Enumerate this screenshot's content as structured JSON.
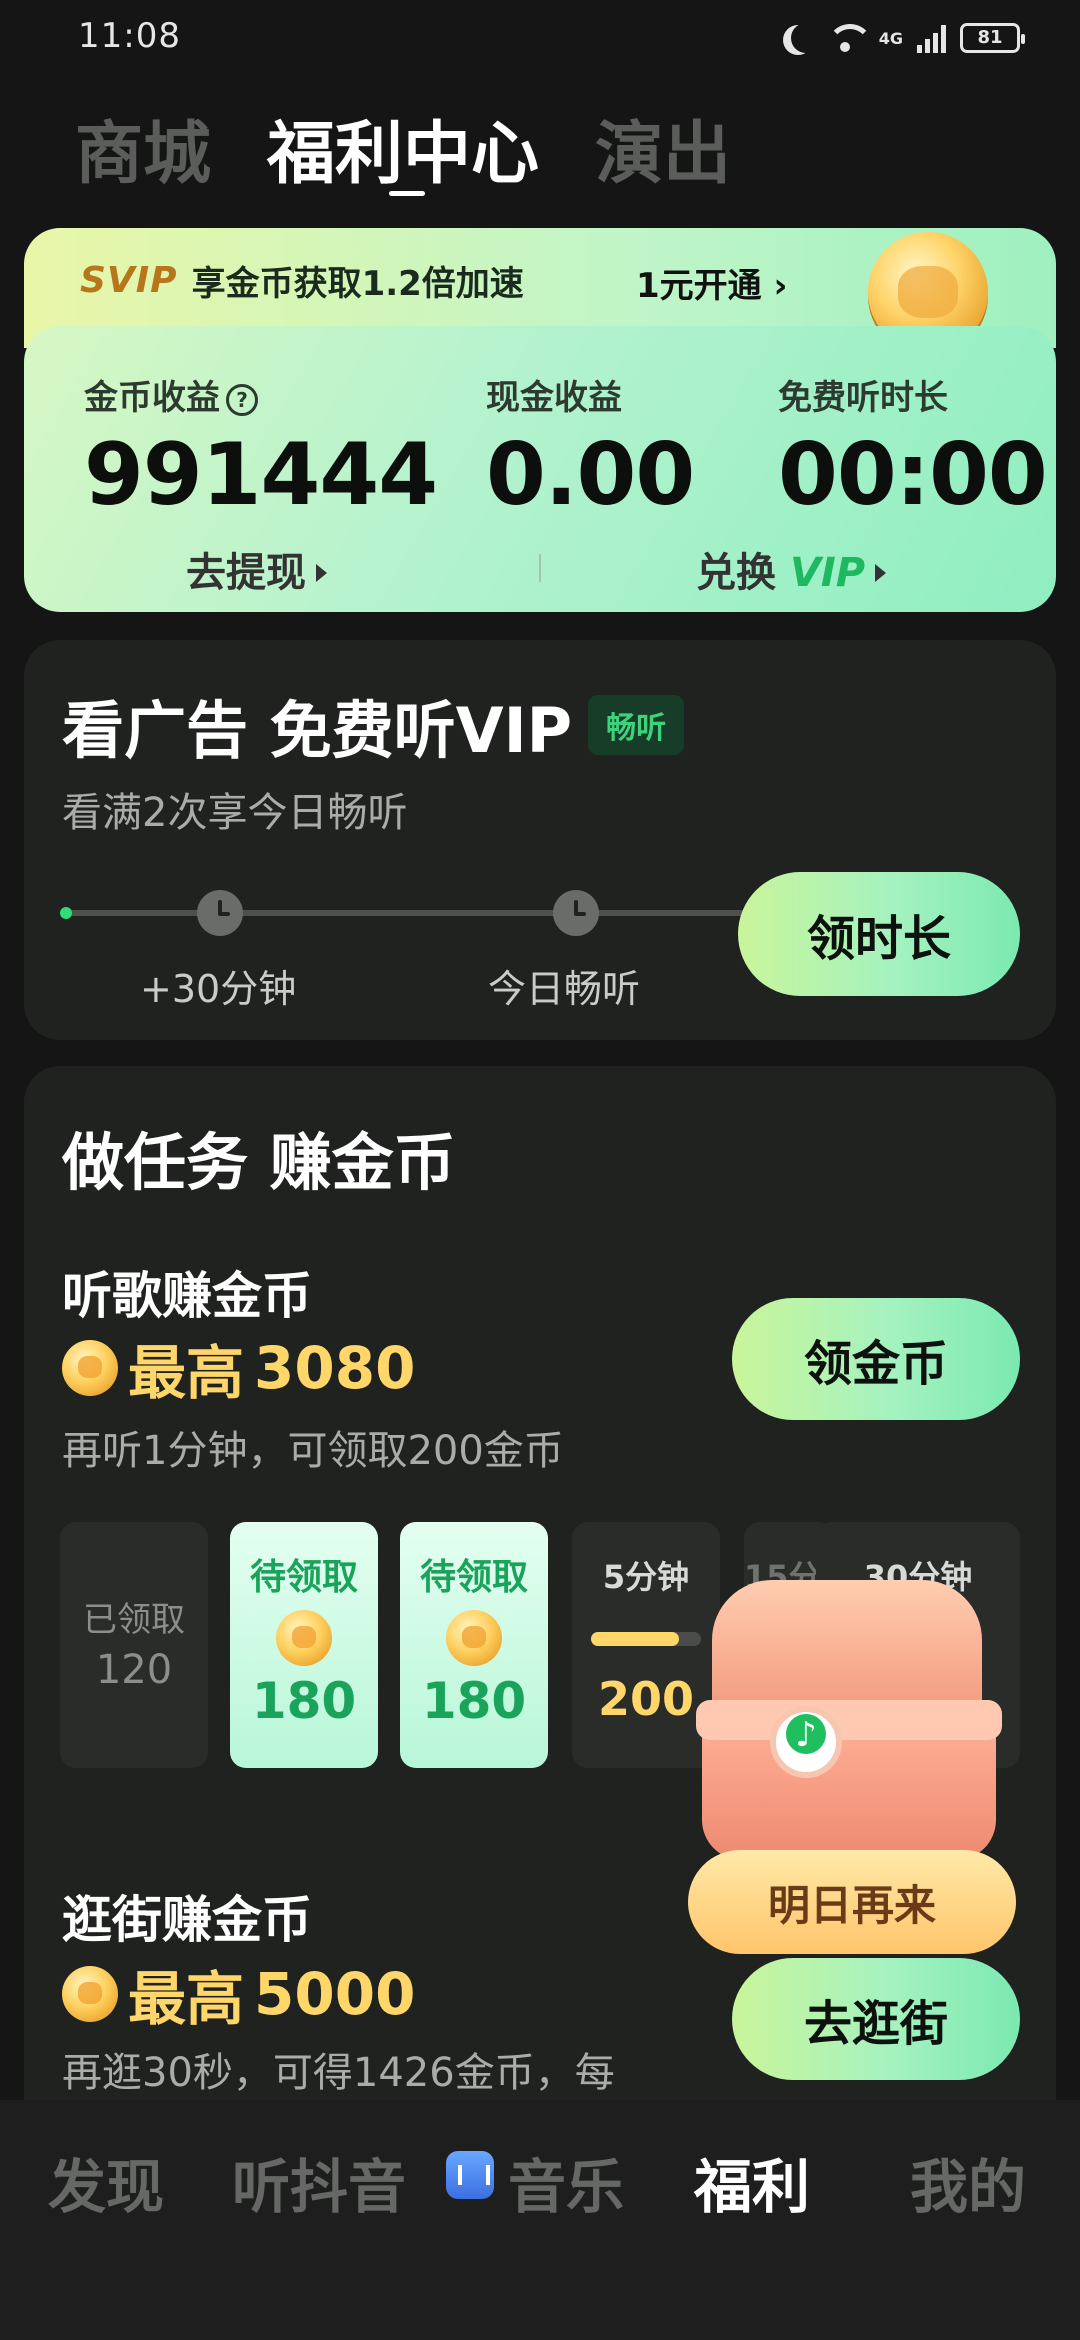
{
  "status": {
    "time": "11:08",
    "network": "4G",
    "battery": "81"
  },
  "top_tabs": [
    "商城",
    "福利中心",
    "演出"
  ],
  "vip_strip": {
    "badge": "SVIP",
    "text": "享金币获取1.2倍加速",
    "open_label": "1元开通 ›"
  },
  "stats": {
    "coins": {
      "label": "金币收益",
      "value": "991444"
    },
    "cash": {
      "label": "现金收益",
      "value": "0.00"
    },
    "free_time": {
      "label": "免费听时长",
      "value": "00:00"
    }
  },
  "card_links": {
    "withdraw": "去提现",
    "exchange_prefix": "兑换",
    "exchange_vip": "VIP"
  },
  "ad_section": {
    "title": "看广告 免费听VIP",
    "badge": "畅听",
    "subtitle": "看满2次享今日畅听",
    "node1_label": "+30分钟",
    "node2_label": "今日畅听",
    "button": "领时长"
  },
  "task_section": {
    "title": "做任务 赚金币",
    "listen": {
      "title": "听歌赚金币",
      "max_prefix": "最高",
      "max_value": "3080",
      "desc": "再听1分钟，可领取200金币",
      "button": "领金币"
    },
    "slots": [
      {
        "status": "已领取",
        "value": "120"
      },
      {
        "status": "待领取",
        "value": "180"
      },
      {
        "status": "待领取",
        "value": "180"
      },
      {
        "status": "5分钟",
        "value": "200",
        "progress": 0.8
      },
      {
        "status": "15分钟",
        "value": ""
      },
      {
        "status": "30分钟",
        "value": ""
      }
    ],
    "chest_label": "明日再来",
    "shop": {
      "title": "逛街赚金币",
      "max_prefix": "最高",
      "max_value": "5000",
      "desc": "再逛30秒，可得1426金币，每",
      "button": "去逛街"
    }
  },
  "bottom_nav": [
    "发现",
    "听抖音",
    "音乐",
    "福利",
    "我的"
  ],
  "colors": {
    "accent_green": "#1aa35a",
    "gold": "#ffd66a",
    "background": "#141514"
  }
}
